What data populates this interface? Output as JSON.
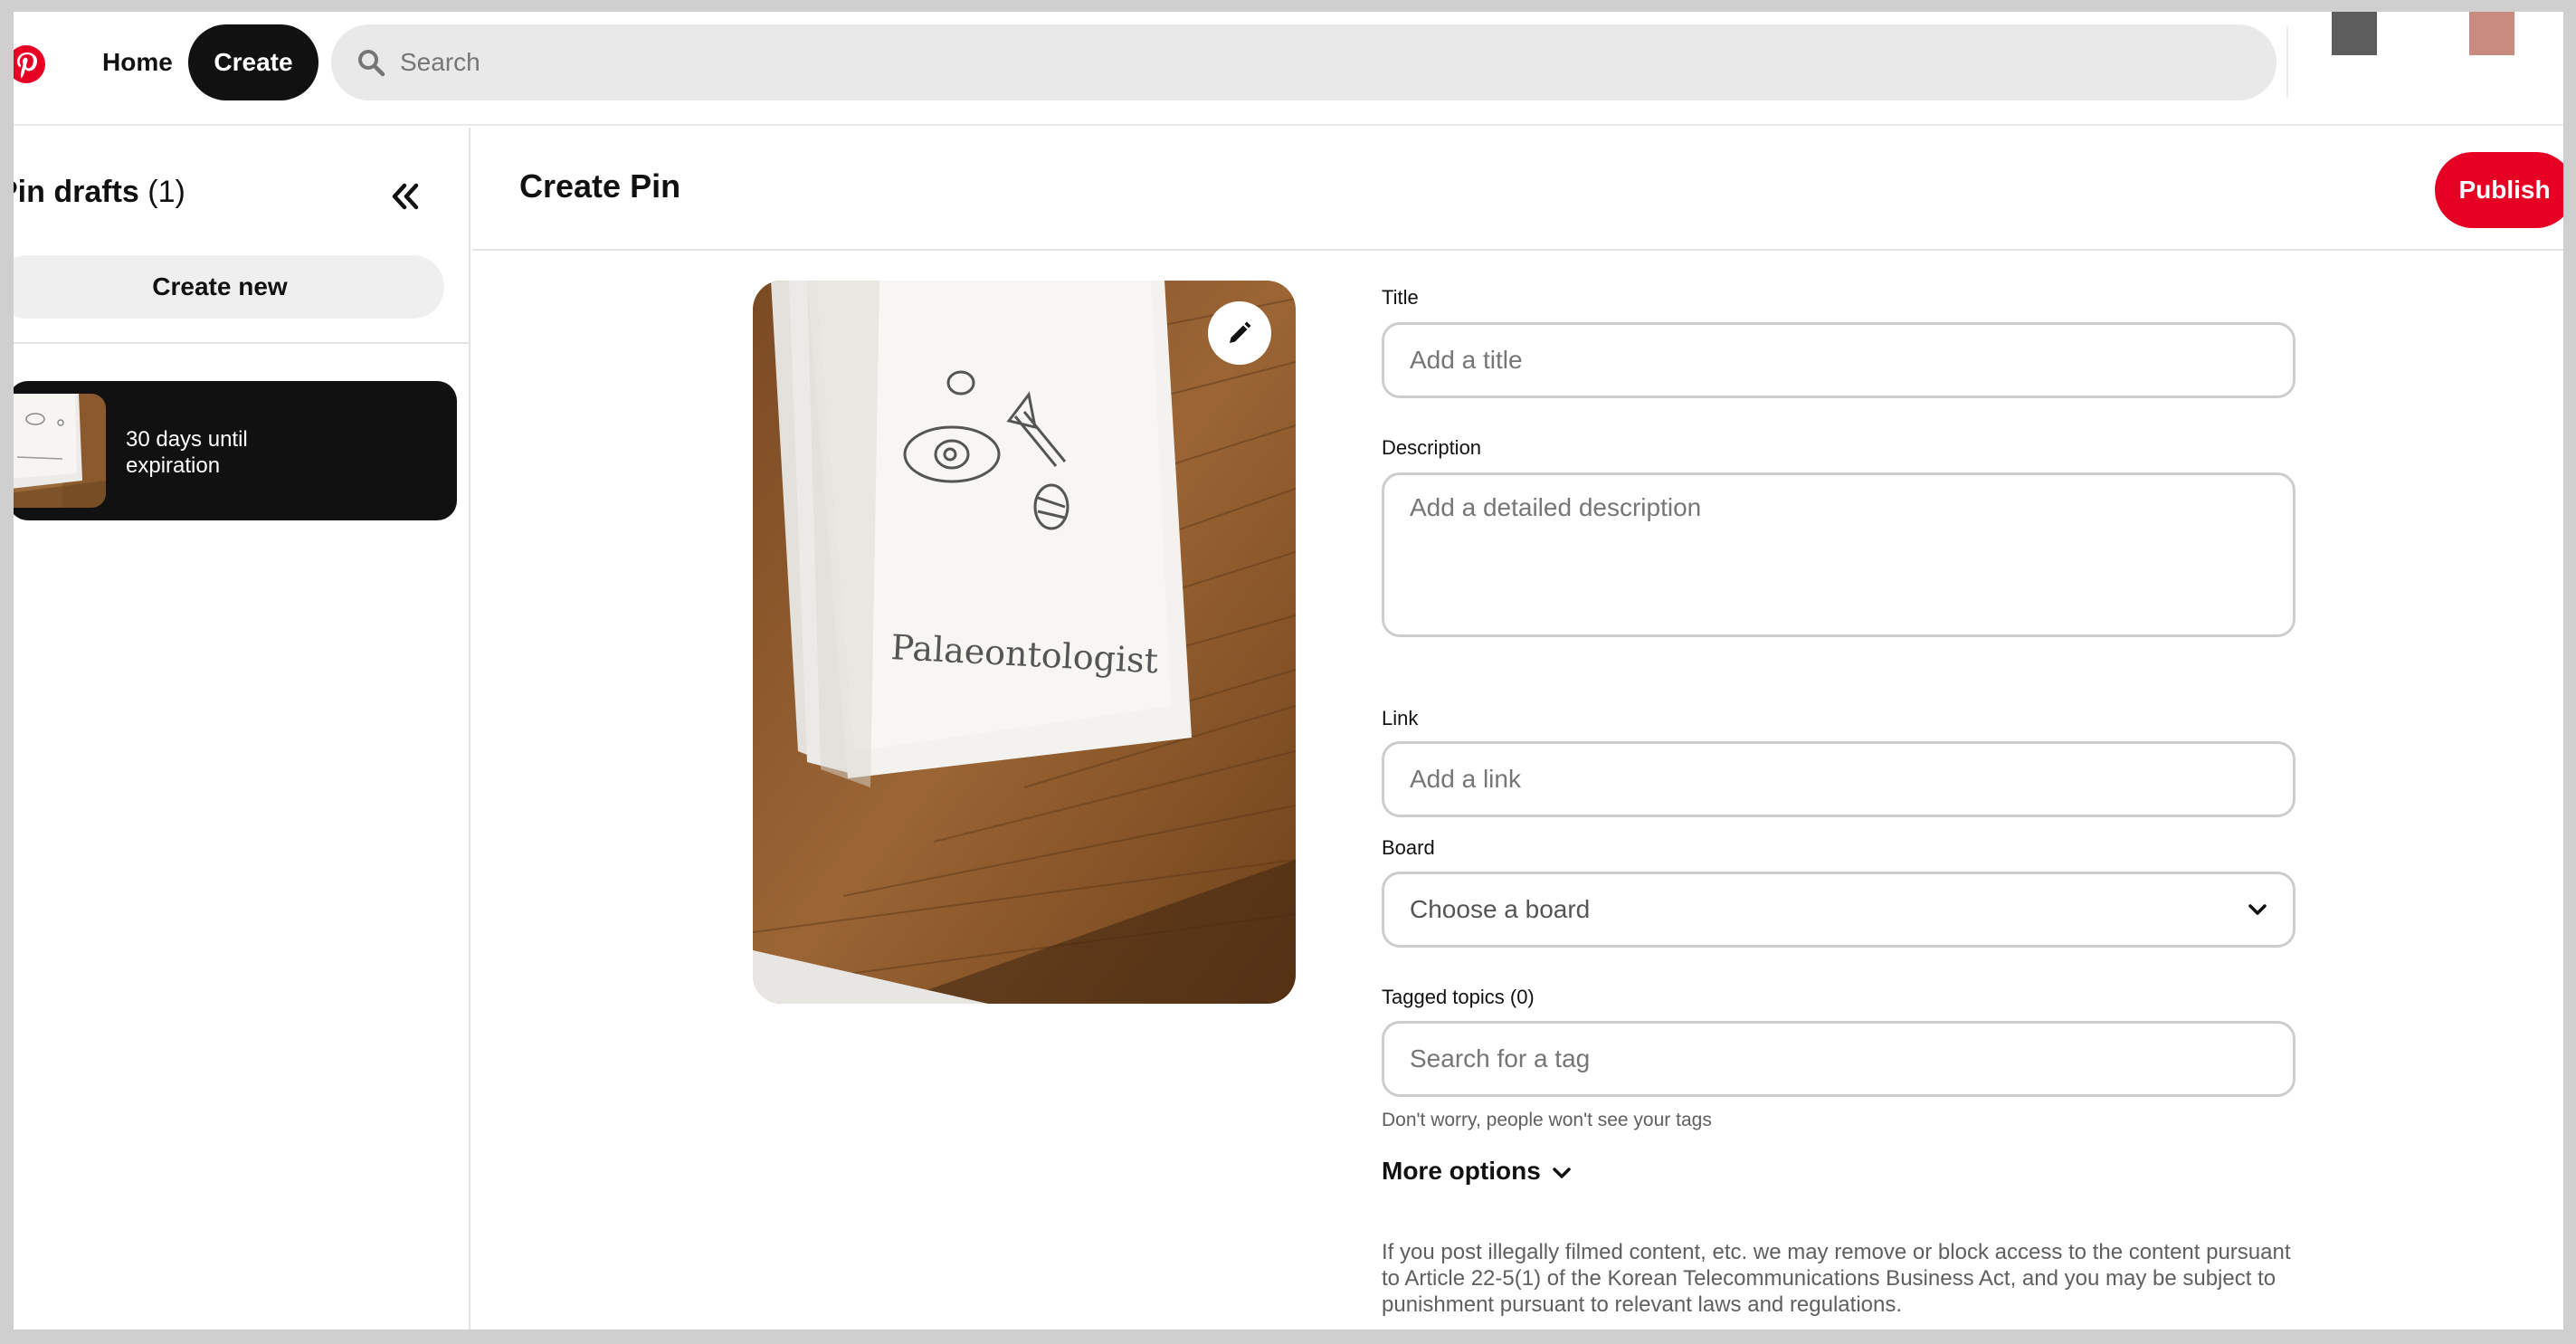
{
  "nav": {
    "home_label": "Home",
    "create_label": "Create",
    "search_placeholder": "Search"
  },
  "sidebar": {
    "title": "Pin drafts",
    "count": "(1)",
    "create_new_label": "Create new",
    "drafts": [
      {
        "expiration": "30 days until expiration"
      }
    ]
  },
  "main": {
    "title": "Create Pin",
    "publish_label": "Publish"
  },
  "pin_image": {
    "caption_handwritten": "Palaeontologist"
  },
  "form": {
    "title_label": "Title",
    "title_placeholder": "Add a title",
    "description_label": "Description",
    "description_placeholder": "Add a detailed description",
    "link_label": "Link",
    "link_placeholder": "Add a link",
    "board_label": "Board",
    "board_value": "Choose a board",
    "tags_label": "Tagged topics (0)",
    "tags_placeholder": "Search for a tag",
    "tags_hint": "Don't worry, people won't see your tags",
    "more_options_label": "More options",
    "legal_text": "If you post illegally filmed content, etc. we may remove or block access to the content pursuant to Article 22-5(1) of the Korean Telecommunications Business Act, and you may be subject to punishment pursuant to relevant laws and regulations."
  },
  "colors": {
    "brand_red": "#e60023",
    "dark": "#111111",
    "field_border": "#cdcdcd",
    "search_bg": "#e9e9e9"
  },
  "icons": [
    "pinterest-logo-icon",
    "search-icon",
    "double-chevron-left-icon",
    "pencil-icon",
    "chevron-down-icon"
  ]
}
